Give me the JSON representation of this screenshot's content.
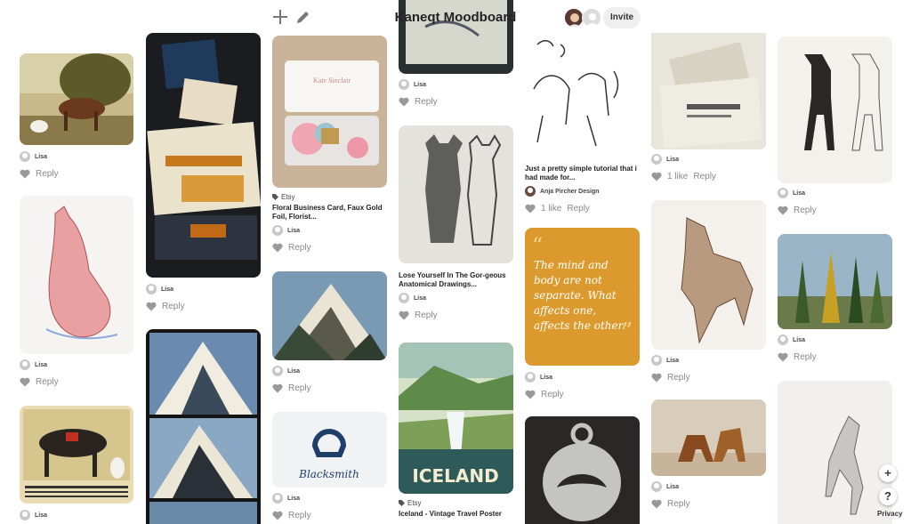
{
  "board": {
    "title": "Kaneqt Moodboard",
    "invite_label": "Invite"
  },
  "toolbar": {
    "add_icon": "plus-icon",
    "edit_icon": "pencil-icon"
  },
  "labels": {
    "reply": "Reply"
  },
  "pins": {
    "p_horse_painting": {
      "user": "Lisa"
    },
    "p_dog_anatomy": {
      "user": "Lisa"
    },
    "p_poster_horse": {
      "user": "Lisa"
    },
    "p_wendigo": {
      "user": "Lisa"
    },
    "p_floral_card": {
      "source": "Etsy",
      "title": "Floral Business Card, Faux Gold Foil, Florist...",
      "user": "Lisa",
      "card_name": "Kate Sinclair"
    },
    "p_mountain_paint": {
      "user": "Lisa"
    },
    "p_etched_top": {
      "user": "Lisa"
    },
    "p_dog_skeleton": {
      "title": "Lose Yourself In The Gor-geous Anatomical Drawings...",
      "user": "Lisa"
    },
    "p_iceland": {
      "source": "Etsy",
      "title": "Iceland - Vintage Travel Poster",
      "poster_word": "ICELAND"
    },
    "p_hind_legs": {
      "title": "Just a pretty simple tutorial that i had made for...",
      "user": "Anja Pircher Design",
      "likes": "1 like"
    },
    "p_quote": {
      "user": "Lisa",
      "quote": "The mind and body are not separate. What affects one, affects the other."
    },
    "p_letterpress": {
      "user": "Lisa",
      "likes": "1 like"
    },
    "p_horse_muscle": {
      "user": "Lisa"
    },
    "p_bronze_horses": {
      "user": "Lisa"
    },
    "p_horse_anatomy": {
      "user": "Lisa"
    },
    "p_trees": {
      "user": "Lisa"
    },
    "p_blacksmith": {
      "user": "Lisa",
      "badge_text": "Blacksmith"
    }
  },
  "floating": {
    "add_label": "+",
    "help_label": "?",
    "privacy_label": "Privacy"
  }
}
